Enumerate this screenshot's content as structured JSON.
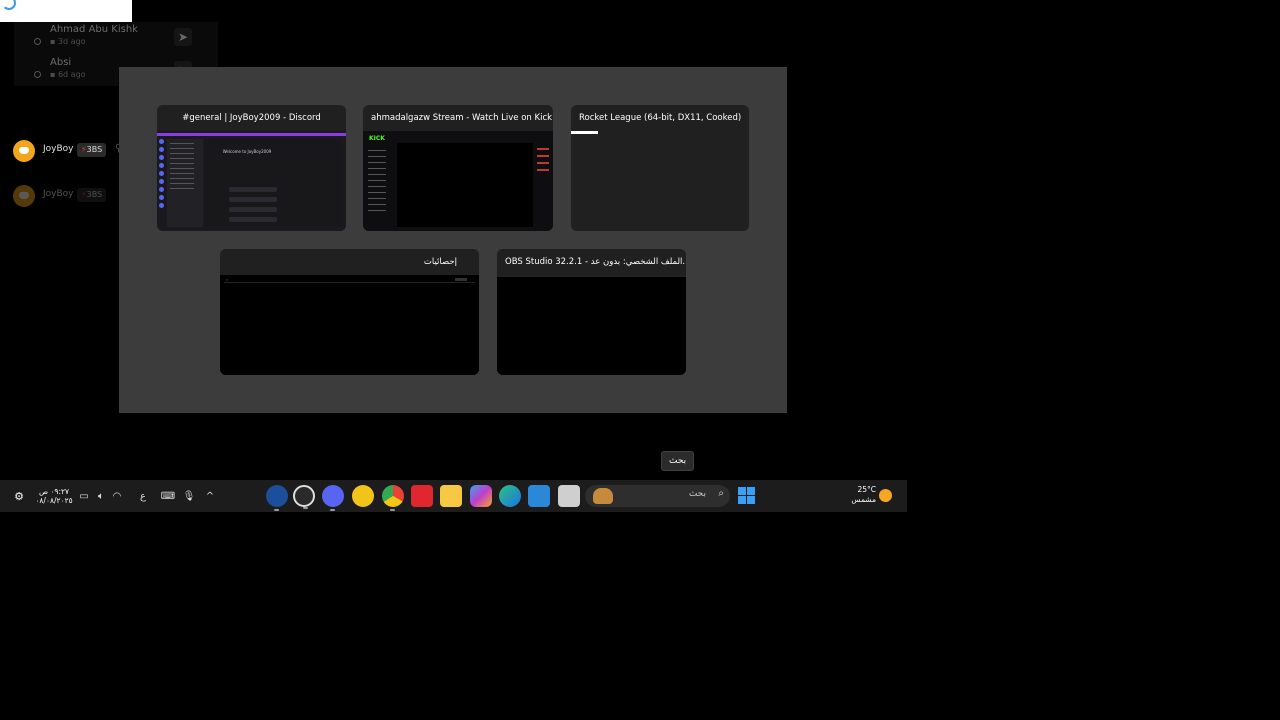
{
  "background": {
    "notifications": [
      {
        "name": "Ahmad Abu Kishk",
        "time": "3d ago"
      },
      {
        "name": "Absi",
        "time": "6d ago"
      }
    ],
    "discord_overlay": [
      {
        "username": "JoyBoy",
        "tag_prefix": "⚡",
        "tag": "3BS"
      },
      {
        "username": "JoyBoy",
        "tag_prefix": "⚡",
        "tag": "3BS"
      }
    ]
  },
  "taskview": {
    "windows": [
      {
        "title": "#general | JoyBoy2009 - Discord",
        "preview": "discord"
      },
      {
        "title": "ahmadalgazw Stream - Watch Live on Kick ...",
        "preview": "kick"
      },
      {
        "title": "Rocket League (64-bit, DX11, Cooked)",
        "preview": "rocketleague"
      },
      {
        "title": "إحصائيات",
        "preview": "stats"
      },
      {
        "title": "OBS Studio 32.2.1 - الملف الشخصي: بدون عد...",
        "preview": "obs"
      }
    ],
    "discord_preview": {
      "welcome": "Welcome to JoyBoy2009"
    },
    "kick_preview": {
      "logo": "KICK"
    }
  },
  "tooltip": "بحث",
  "taskbar": {
    "clock_time": "٠٩:٢٧ ص",
    "clock_date": "٠٨/٠٨/٢٠٢٥",
    "language": "ع",
    "search_label": "بحث",
    "weather_temp": "25°C",
    "weather_desc": "مشمس",
    "apps": [
      "rocket-league",
      "obs",
      "discord",
      "bot",
      "chrome",
      "wps",
      "file-explorer",
      "copilot",
      "edge",
      "photos",
      "window"
    ],
    "colors": {
      "accent": "#3aa0f5",
      "discord": "#5865f2",
      "chrome": "#e94235",
      "wps": "#e0262f",
      "folder": "#f7c843"
    }
  }
}
